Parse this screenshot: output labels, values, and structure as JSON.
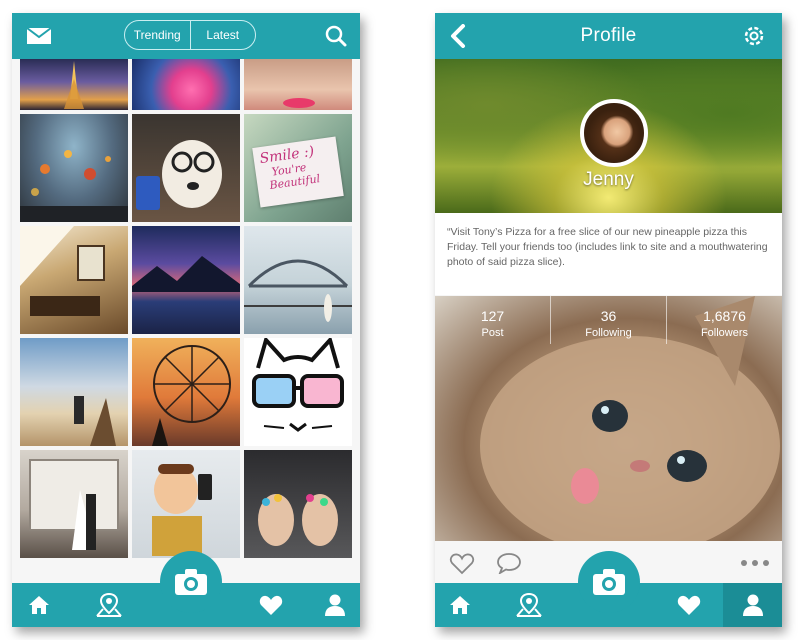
{
  "feed": {
    "tabs": [
      {
        "label": "Trending"
      },
      {
        "label": "Latest"
      }
    ],
    "header_icons": [
      "mail-icon",
      "search-icon"
    ],
    "tiles": [
      "Eiffel Tower at dusk",
      "Pink coral on blue",
      "Woman with red lips",
      "Hot air balloons",
      "Dog with glasses",
      "Smile note",
      "Attic bedroom",
      "Mountain lake sunset",
      "Harbour bridge",
      "Woman on pier",
      "Ferris wheel sunset",
      "Cat with rainbow glasses",
      "Wedding couple",
      "Toy with phone",
      "Nail art hands"
    ],
    "smile_note": {
      "line1": "Smile :)",
      "line2": "You're",
      "line3": "Beautiful"
    }
  },
  "profile": {
    "title": "Profile",
    "name": "Jenny",
    "post_text": "“Visit Tony’s Pizza for a free slice of our new pineapple pizza this Friday. Tell your friends too (includes link to site and a mouthwatering photo of said pizza slice).",
    "stats": [
      {
        "value": "127",
        "label": "Post"
      },
      {
        "value": "36",
        "label": "Following"
      },
      {
        "value": "1,6876",
        "label": "Followers"
      }
    ]
  },
  "nav": [
    "home-icon",
    "map-pin-icon",
    "camera-icon",
    "heart-icon",
    "user-icon"
  ],
  "colors": {
    "accent": "#23a3ad",
    "active_nav": "#1b8d96"
  }
}
